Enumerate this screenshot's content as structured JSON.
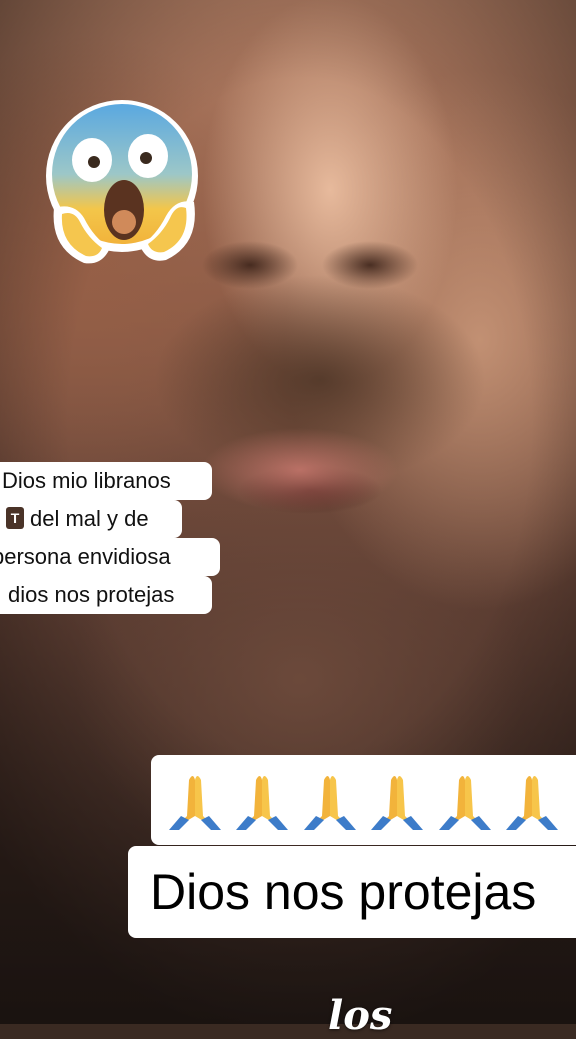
{
  "caption": {
    "lines": [
      "Dios mio libranos",
      "del mal y de",
      "persona envidiosa",
      "dios nos protejas"
    ],
    "inline_icon": "tiktok-t-icon"
  },
  "sticker": {
    "emoji": "face-screaming-in-fear-icon"
  },
  "hands": {
    "emoji": "folded-hands-icon",
    "count": 6
  },
  "title": "Dios nos protejas",
  "bottom_text": "los",
  "colors": {
    "caption_bg": "#ffffff",
    "caption_text": "#111111",
    "title_text": "#000000",
    "bottom_text": "#ffffff"
  }
}
